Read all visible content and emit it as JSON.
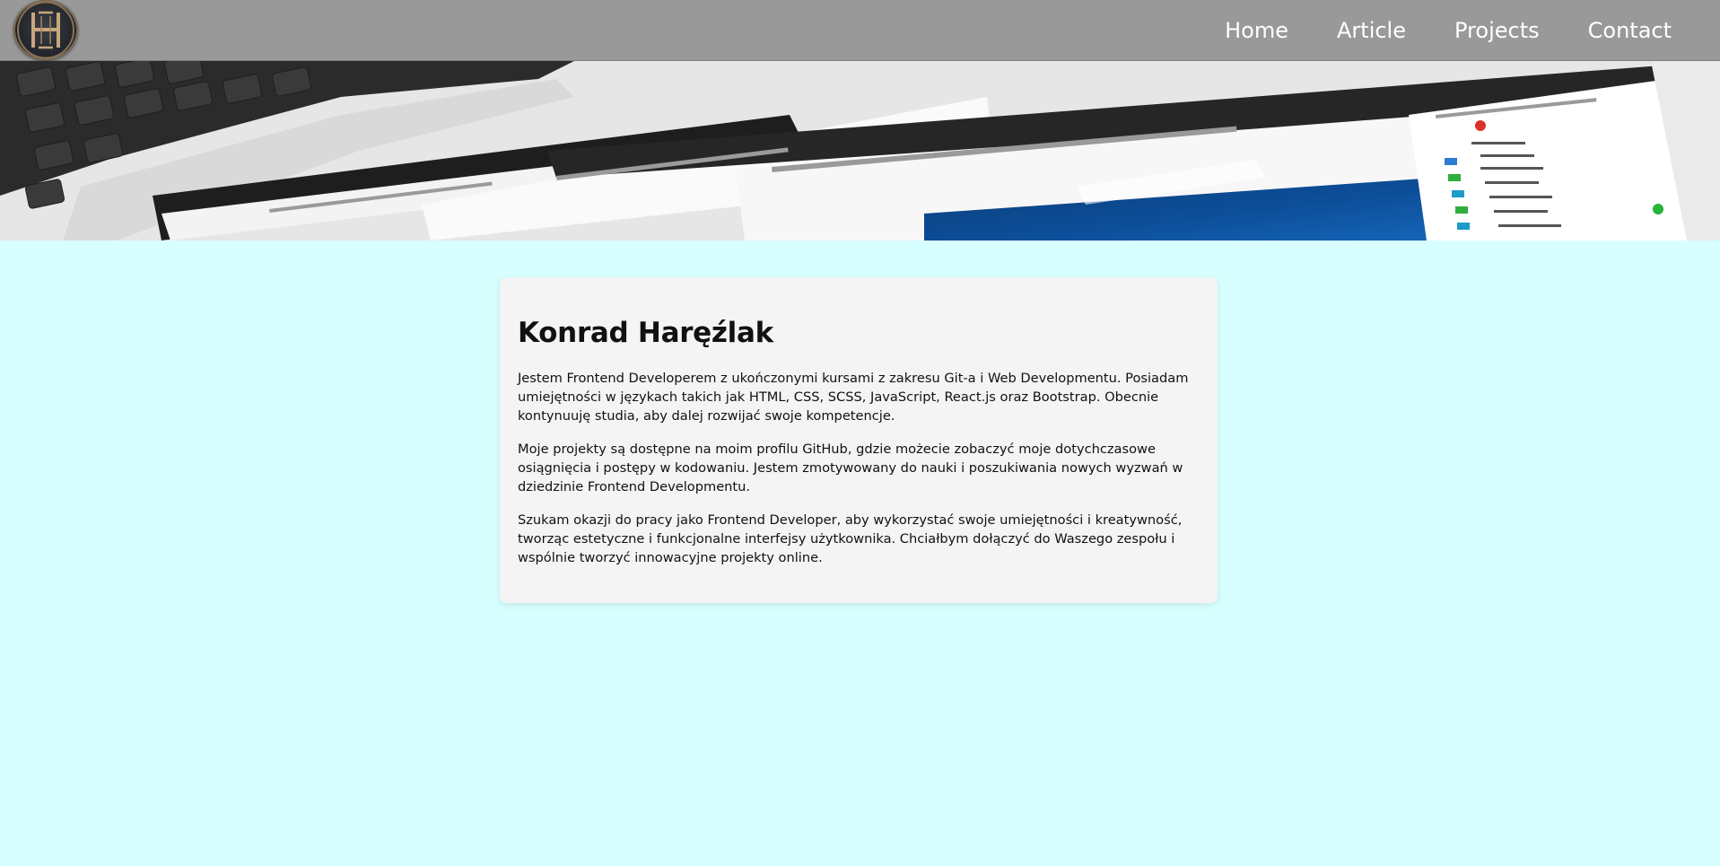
{
  "nav": {
    "logo_icon": "h-monogram-logo-icon",
    "links": [
      {
        "label": "Home"
      },
      {
        "label": "Article"
      },
      {
        "label": "Projects"
      },
      {
        "label": "Contact"
      }
    ]
  },
  "hero": {
    "image": "laptop-screens-banner"
  },
  "about": {
    "name": "Konrad Haręźlak",
    "paragraphs": [
      "Jestem Frontend Developerem z ukończonymi kursami z zakresu Git-a i Web Developmentu. Posiadam umiejętności w językach takich jak HTML, CSS, SCSS, JavaScript, React.js oraz Bootstrap. Obecnie kontynuuję studia, aby dalej rozwijać swoje kompetencje.",
      "Moje projekty są dostępne na moim profilu GitHub, gdzie możecie zobaczyć moje dotychczasowe osiągnięcia i postępy w kodowaniu. Jestem zmotywowany do nauki i poszukiwania nowych wyzwań w dziedzinie Frontend Developmentu.",
      "Szukam okazji do pracy jako Frontend Developer, aby wykorzystać swoje umiejętności i kreatywność, tworząc estetyczne i funkcjonalne interfejsy użytkownika. Chciałbym dołączyć do Waszego zespołu i wspólnie tworzyć innowacyjne projekty online."
    ]
  },
  "colors": {
    "navbar": "#999999",
    "background": "#d8ffff",
    "card": "#f4f4f4",
    "nav_text": "#ffffff"
  }
}
